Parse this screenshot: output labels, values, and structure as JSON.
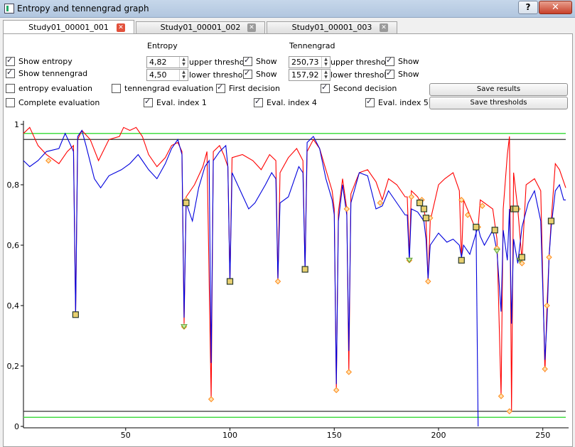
{
  "window": {
    "title": "Entropy and tennengrad graph",
    "help_label": "?",
    "close_label": "✕"
  },
  "tabs": [
    {
      "label": "Study01_00001_001",
      "active": true
    },
    {
      "label": "Study01_00001_002",
      "active": false
    },
    {
      "label": "Study01_00001_003",
      "active": false
    }
  ],
  "controls": {
    "show_entropy": {
      "label": "Show entropy",
      "checked": true
    },
    "show_tennengrad": {
      "label": "Show tennengrad",
      "checked": true
    },
    "entropy_group": {
      "title": "Entropy",
      "upper_value": "4,82",
      "upper_label": "upper threshold",
      "lower_value": "4,50",
      "lower_label": "lower threshold",
      "show_upper": {
        "label": "Show",
        "checked": true
      },
      "show_lower": {
        "label": "Show",
        "checked": true
      }
    },
    "tennengrad_group": {
      "title": "Tennengrad",
      "upper_value": "250,73",
      "upper_label": "upper threshold",
      "lower_value": "157,92",
      "lower_label": "lower threshold",
      "show_upper": {
        "label": "Show",
        "checked": true
      },
      "show_lower": {
        "label": "Show",
        "checked": true
      }
    },
    "entropy_evaluation": {
      "label": "entropy evaluation",
      "checked": false
    },
    "tennengrad_evaluation": {
      "label": "tennengrad evaluation",
      "checked": false
    },
    "first_decision": {
      "label": "First decision",
      "checked": true
    },
    "second_decision": {
      "label": "Second decision",
      "checked": true
    },
    "complete_evaluation": {
      "label": "Complete evaluation",
      "checked": false
    },
    "eval_index_1": {
      "label": "Eval. index 1",
      "checked": true
    },
    "eval_index_4": {
      "label": "Eval. index 4",
      "checked": true
    },
    "eval_index_5": {
      "label": "Eval. index 5",
      "checked": true
    },
    "save_results_label": "Save results",
    "save_thresholds_label": "Save thresholds"
  },
  "colors": {
    "entropy": "#ff0000",
    "tennengrad": "#0000dd",
    "threshold_green": "#44dd44",
    "threshold_dark": "#333333",
    "marker_orange": "#ff8c1a",
    "marker_square": "#2a3a2a"
  },
  "chart_data": {
    "type": "line",
    "title": "",
    "xlabel": "",
    "ylabel": "",
    "xlim": [
      1,
      261
    ],
    "ylim": [
      0,
      1
    ],
    "x_ticks": [
      50,
      100,
      150,
      200,
      250
    ],
    "y_ticks": [
      0,
      0.2,
      0.4,
      0.6,
      0.8,
      1
    ],
    "y_tick_labels": [
      "0",
      "0,2",
      "0,4",
      "0,6",
      "0,8",
      "1"
    ],
    "thresholds": [
      {
        "y": 0.97,
        "color": "green"
      },
      {
        "y": 0.95,
        "color": "dark"
      },
      {
        "y": 0.05,
        "color": "dark"
      },
      {
        "y": 0.03,
        "color": "green"
      }
    ],
    "series": [
      {
        "key": "entropy",
        "points": [
          [
            1,
            0.97
          ],
          [
            4,
            0.99
          ],
          [
            8,
            0.93
          ],
          [
            12,
            0.9
          ],
          [
            18,
            0.87
          ],
          [
            22,
            0.91
          ],
          [
            25,
            0.93
          ],
          [
            26,
            0.37
          ],
          [
            27,
            0.95
          ],
          [
            29,
            0.98
          ],
          [
            33,
            0.95
          ],
          [
            37,
            0.88
          ],
          [
            42,
            0.95
          ],
          [
            47,
            0.96
          ],
          [
            49,
            0.99
          ],
          [
            52,
            0.98
          ],
          [
            55,
            0.99
          ],
          [
            58,
            0.96
          ],
          [
            61,
            0.9
          ],
          [
            65,
            0.86
          ],
          [
            69,
            0.89
          ],
          [
            72,
            0.93
          ],
          [
            75,
            0.94
          ],
          [
            77,
            0.91
          ],
          [
            78,
            0.34
          ],
          [
            79,
            0.76
          ],
          [
            83,
            0.8
          ],
          [
            87,
            0.86
          ],
          [
            89,
            0.91
          ],
          [
            91,
            0.09
          ],
          [
            92,
            0.91
          ],
          [
            95,
            0.93
          ],
          [
            97,
            0.9
          ],
          [
            99,
            0.86
          ],
          [
            100,
            0.48
          ],
          [
            101,
            0.89
          ],
          [
            106,
            0.9
          ],
          [
            111,
            0.88
          ],
          [
            115,
            0.85
          ],
          [
            119,
            0.9
          ],
          [
            122,
            0.88
          ],
          [
            123,
            0.48
          ],
          [
            124,
            0.84
          ],
          [
            128,
            0.89
          ],
          [
            132,
            0.92
          ],
          [
            135,
            0.88
          ],
          [
            136,
            0.52
          ],
          [
            137,
            0.91
          ],
          [
            140,
            0.95
          ],
          [
            143,
            0.92
          ],
          [
            146,
            0.85
          ],
          [
            149,
            0.78
          ],
          [
            150,
            0.72
          ],
          [
            151,
            0.12
          ],
          [
            152,
            0.71
          ],
          [
            154,
            0.82
          ],
          [
            156,
            0.72
          ],
          [
            157,
            0.18
          ],
          [
            158,
            0.77
          ],
          [
            162,
            0.84
          ],
          [
            166,
            0.85
          ],
          [
            170,
            0.81
          ],
          [
            173,
            0.75
          ],
          [
            176,
            0.82
          ],
          [
            180,
            0.8
          ],
          [
            184,
            0.76
          ],
          [
            185,
            0.76
          ],
          [
            186,
            0.56
          ],
          [
            187,
            0.78
          ],
          [
            190,
            0.76
          ],
          [
            193,
            0.72
          ],
          [
            194,
            0.68
          ],
          [
            195,
            0.48
          ],
          [
            196,
            0.68
          ],
          [
            200,
            0.8
          ],
          [
            203,
            0.82
          ],
          [
            207,
            0.84
          ],
          [
            210,
            0.78
          ],
          [
            211,
            0.55
          ],
          [
            212,
            0.75
          ],
          [
            215,
            0.7
          ],
          [
            218,
            0.65
          ],
          [
            219,
            0.66
          ],
          [
            220,
            0.75
          ],
          [
            222,
            0.74
          ],
          [
            226,
            0.72
          ],
          [
            228,
            0.62
          ],
          [
            230,
            0.1
          ],
          [
            231,
            0.72
          ],
          [
            233,
            0.9
          ],
          [
            234,
            0.96
          ],
          [
            235,
            0.05
          ],
          [
            236,
            0.84
          ],
          [
            238,
            0.72
          ],
          [
            240,
            0.55
          ],
          [
            242,
            0.8
          ],
          [
            246,
            0.82
          ],
          [
            249,
            0.78
          ],
          [
            251,
            0.18
          ],
          [
            252,
            0.4
          ],
          [
            253,
            0.56
          ],
          [
            254,
            0.68
          ],
          [
            256,
            0.87
          ],
          [
            258,
            0.85
          ],
          [
            261,
            0.79
          ]
        ]
      },
      {
        "key": "tennengrad",
        "points": [
          [
            1,
            0.88
          ],
          [
            4,
            0.86
          ],
          [
            8,
            0.88
          ],
          [
            12,
            0.91
          ],
          [
            18,
            0.92
          ],
          [
            21,
            0.97
          ],
          [
            23,
            0.94
          ],
          [
            25,
            0.91
          ],
          [
            26,
            0.37
          ],
          [
            27,
            0.96
          ],
          [
            29,
            0.98
          ],
          [
            31,
            0.93
          ],
          [
            35,
            0.82
          ],
          [
            38,
            0.79
          ],
          [
            42,
            0.83
          ],
          [
            45,
            0.84
          ],
          [
            48,
            0.85
          ],
          [
            52,
            0.87
          ],
          [
            56,
            0.9
          ],
          [
            58,
            0.88
          ],
          [
            61,
            0.85
          ],
          [
            65,
            0.82
          ],
          [
            69,
            0.87
          ],
          [
            72,
            0.92
          ],
          [
            75,
            0.95
          ],
          [
            77,
            0.9
          ],
          [
            78,
            0.36
          ],
          [
            79,
            0.74
          ],
          [
            82,
            0.68
          ],
          [
            85,
            0.79
          ],
          [
            88,
            0.86
          ],
          [
            90,
            0.88
          ],
          [
            91,
            0.21
          ],
          [
            92,
            0.88
          ],
          [
            95,
            0.91
          ],
          [
            98,
            0.93
          ],
          [
            99,
            0.86
          ],
          [
            100,
            0.48
          ],
          [
            101,
            0.84
          ],
          [
            105,
            0.78
          ],
          [
            109,
            0.72
          ],
          [
            112,
            0.74
          ],
          [
            117,
            0.8
          ],
          [
            120,
            0.84
          ],
          [
            122,
            0.82
          ],
          [
            123,
            0.49
          ],
          [
            124,
            0.74
          ],
          [
            128,
            0.76
          ],
          [
            133,
            0.86
          ],
          [
            135,
            0.84
          ],
          [
            136,
            0.52
          ],
          [
            137,
            0.94
          ],
          [
            140,
            0.96
          ],
          [
            143,
            0.92
          ],
          [
            146,
            0.82
          ],
          [
            149,
            0.75
          ],
          [
            150,
            0.7
          ],
          [
            151,
            0.14
          ],
          [
            152,
            0.68
          ],
          [
            154,
            0.8
          ],
          [
            156,
            0.7
          ],
          [
            157,
            0.25
          ],
          [
            158,
            0.74
          ],
          [
            162,
            0.84
          ],
          [
            166,
            0.83
          ],
          [
            170,
            0.72
          ],
          [
            173,
            0.73
          ],
          [
            176,
            0.78
          ],
          [
            180,
            0.74
          ],
          [
            184,
            0.7
          ],
          [
            185,
            0.7
          ],
          [
            186,
            0.55
          ],
          [
            187,
            0.72
          ],
          [
            190,
            0.71
          ],
          [
            193,
            0.68
          ],
          [
            194,
            0.62
          ],
          [
            195,
            0.49
          ],
          [
            196,
            0.6
          ],
          [
            200,
            0.64
          ],
          [
            204,
            0.61
          ],
          [
            207,
            0.62
          ],
          [
            210,
            0.6
          ],
          [
            211,
            0.56
          ],
          [
            212,
            0.6
          ],
          [
            215,
            0.57
          ],
          [
            218,
            0.64
          ],
          [
            219,
            0.66
          ],
          [
            220,
            0.63
          ],
          [
            222,
            0.6
          ],
          [
            226,
            0.65
          ],
          [
            228,
            0.58
          ],
          [
            230,
            0.38
          ],
          [
            231,
            0.65
          ],
          [
            233,
            0.55
          ],
          [
            234,
            0.72
          ],
          [
            235,
            0.34
          ],
          [
            236,
            0.62
          ],
          [
            238,
            0.54
          ],
          [
            240,
            0.66
          ],
          [
            243,
            0.74
          ],
          [
            246,
            0.78
          ],
          [
            249,
            0.68
          ],
          [
            251,
            0.22
          ],
          [
            252,
            0.35
          ],
          [
            253,
            0.56
          ],
          [
            254,
            0.66
          ],
          [
            256,
            0.78
          ],
          [
            258,
            0.8
          ],
          [
            260,
            0.75
          ],
          [
            261,
            0.75
          ]
        ]
      },
      {
        "key": "tennengrad_drop",
        "points": [
          [
            218,
            0.66
          ],
          [
            219,
            0
          ]
        ]
      }
    ],
    "orange_markers": [
      [
        13,
        0.88
      ],
      [
        26,
        0.37
      ],
      [
        78,
        0.33
      ],
      [
        79,
        0.75
      ],
      [
        91,
        0.09
      ],
      [
        123,
        0.48
      ],
      [
        136,
        0.52
      ],
      [
        151,
        0.12
      ],
      [
        156,
        0.72
      ],
      [
        157,
        0.18
      ],
      [
        172,
        0.74
      ],
      [
        186,
        0.55
      ],
      [
        187,
        0.76
      ],
      [
        192,
        0.75
      ],
      [
        195,
        0.48
      ],
      [
        196,
        0.69
      ],
      [
        211,
        0.75
      ],
      [
        214,
        0.7
      ],
      [
        219,
        0.66
      ],
      [
        221,
        0.73
      ],
      [
        228,
        0.59
      ],
      [
        230,
        0.1
      ],
      [
        234,
        0.05
      ],
      [
        238,
        0.72
      ],
      [
        240,
        0.54
      ],
      [
        251,
        0.19
      ],
      [
        252,
        0.4
      ],
      [
        253,
        0.56
      ],
      [
        254,
        0.68
      ]
    ],
    "square_markers": [
      [
        26,
        0.37
      ],
      [
        79,
        0.74
      ],
      [
        100,
        0.48
      ],
      [
        136,
        0.52
      ],
      [
        191,
        0.74
      ],
      [
        193,
        0.72
      ],
      [
        194,
        0.69
      ],
      [
        211,
        0.55
      ],
      [
        218,
        0.66
      ],
      [
        227,
        0.65
      ],
      [
        236,
        0.72
      ],
      [
        237,
        0.72
      ],
      [
        240,
        0.56
      ],
      [
        254,
        0.68
      ]
    ],
    "green_markers": [
      [
        78,
        0.33
      ],
      [
        186,
        0.55
      ],
      [
        228,
        0.58
      ],
      [
        239,
        0.55
      ]
    ]
  }
}
